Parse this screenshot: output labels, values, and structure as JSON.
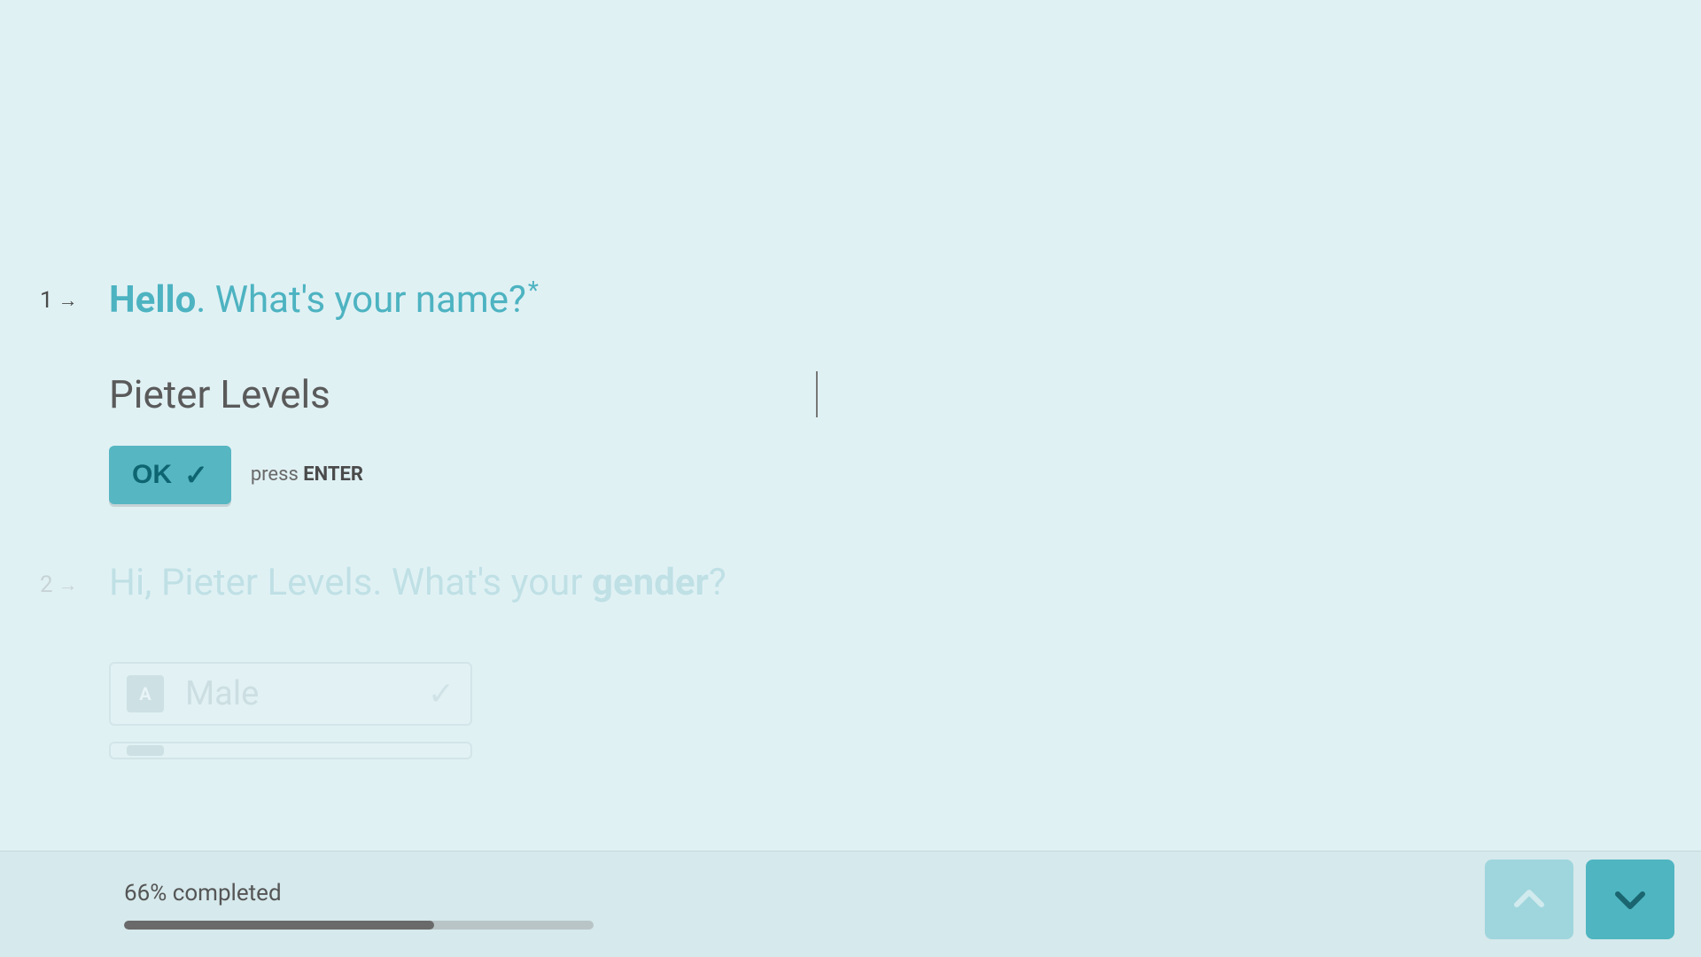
{
  "questions": [
    {
      "number": "1",
      "prompt_bold": "Hello",
      "prompt_rest": ". What's your name?",
      "required": true,
      "answer_value": "Pieter Levels",
      "ok_label": "OK",
      "press_label": "press ",
      "enter_label": "ENTER"
    },
    {
      "number": "2",
      "prompt_prefix": "Hi, ",
      "prompt_name": "Pieter Levels",
      "prompt_mid": ". What's your ",
      "prompt_bold": "gender",
      "prompt_suffix": "?",
      "options": [
        {
          "key": "A",
          "label": "Male",
          "selected": true
        }
      ]
    }
  ],
  "footer": {
    "progress_percent": 66,
    "progress_text": "66% completed"
  },
  "icons": {
    "arrow_right": "→",
    "check": "✓"
  }
}
